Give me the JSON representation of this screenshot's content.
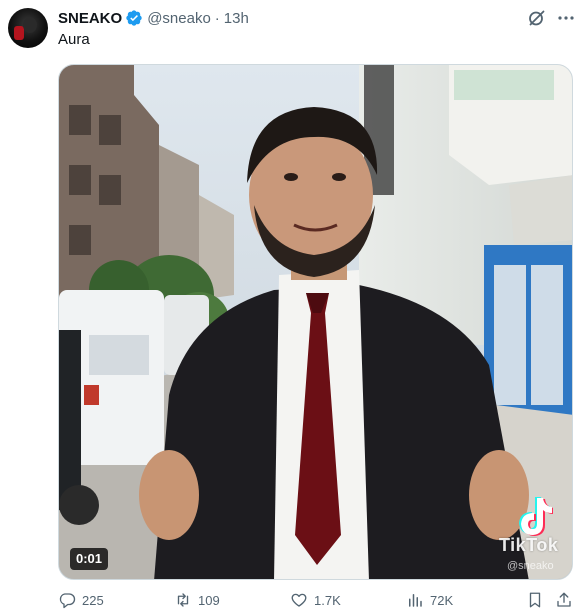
{
  "author": {
    "name": "SNEAKO",
    "handle": "@sneako",
    "separator": "·",
    "time": "13h",
    "verified": true
  },
  "tweet": {
    "text": "Aura"
  },
  "media": {
    "type": "video",
    "timestamp": "0:01",
    "watermark": "TikTok",
    "watermark_handle": "@sneako"
  },
  "actions": {
    "replies": "225",
    "retweets": "109",
    "likes": "1.7K",
    "views": "72K"
  },
  "icons": {
    "verified": "verified-badge-icon",
    "grok": "grok-icon",
    "reply": "reply-icon",
    "retweet": "retweet-icon",
    "like": "heart-icon",
    "views": "bar-chart-icon",
    "bookmark": "bookmark-icon",
    "share": "share-icon"
  },
  "colors": {
    "text": "#0f1419",
    "secondary": "#536471",
    "verified": "#1d9bf0",
    "border": "#cfd9de"
  }
}
